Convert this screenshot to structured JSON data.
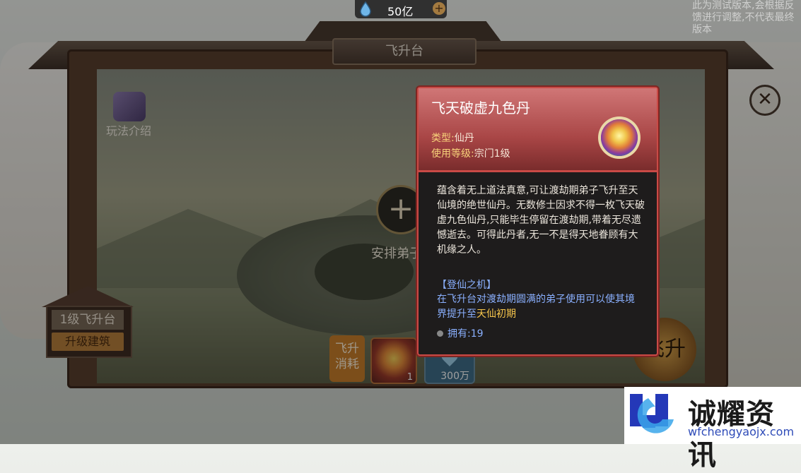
{
  "top_bar": {
    "currency_value": "50亿",
    "add_symbol": "+"
  },
  "notice_text": "此为测试版本,会根据反馈进行调整,不代表最终版本",
  "building": {
    "title": "飞升台",
    "intro_label": "玩法介绍",
    "level_label": "1级飞升台",
    "upgrade_label": "升级建筑",
    "add_symbol": "+",
    "arrange_label": "安排弟子",
    "cost_label": "飞升\n消耗",
    "cost_pill_count": "1",
    "cost_water_count": "300万",
    "ascend_label": "飞升"
  },
  "close_symbol": "✕",
  "tooltip": {
    "name": "飞天破虚九色丹",
    "type_key": "类型:",
    "type_value": "仙丹",
    "level_key": "使用等级:",
    "level_value": "宗门1级",
    "description": "蕴含着无上道法真意,可让渡劫期弟子飞升至天仙境的绝世仙丹。无数修士因求不得一枚飞天破虚九色仙丹,只能毕生停留在渡劫期,带着无尽遗憾逝去。可得此丹者,无一不是得天地眷顾有大机缘之人。",
    "section_title": "【登仙之机】",
    "section_text_before": "在飞升台对渡劫期圆满的弟子使用可以使其境界提升至",
    "section_text_highlight": "天仙初期",
    "own_label": "拥有:",
    "own_count": "19"
  },
  "watermark": {
    "name": "诚耀资讯",
    "url": "wfchengyaojx.com"
  },
  "colors": {
    "tooltip_border": "#c94a46",
    "highlight_blue": "#8ab0ff",
    "highlight_gold": "#f7c64c",
    "accent_orange": "#c97f2a"
  },
  "icons": [
    "water-drop-icon",
    "plus-icon",
    "book-icon",
    "close-icon",
    "pill-icon",
    "water-icon",
    "watermark-logo-icon"
  ]
}
